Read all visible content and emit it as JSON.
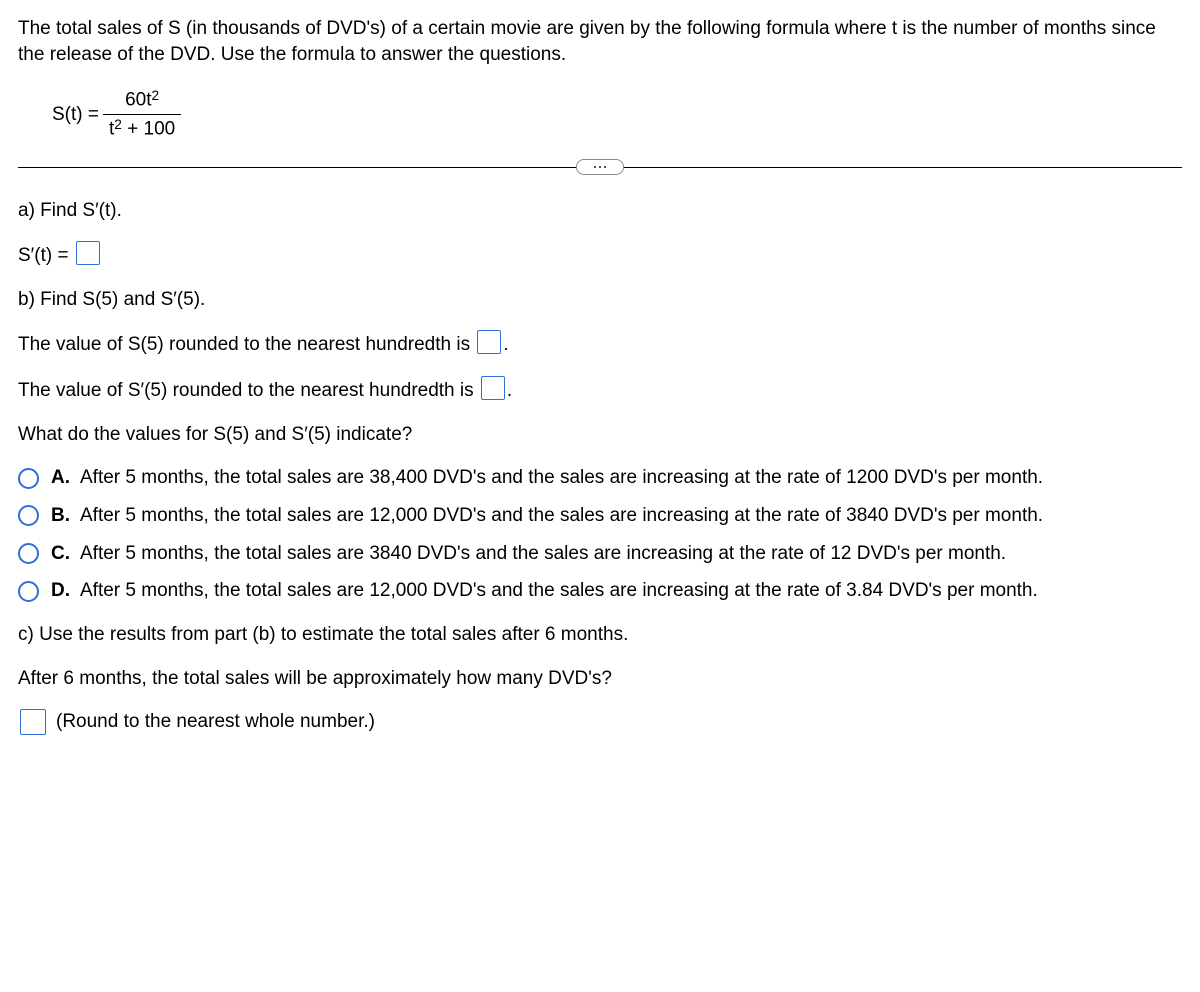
{
  "intro": "The total sales of S (in thousands of DVD's) of a certain movie are given by the following formula where t is the number of months since the release of the DVD. Use the formula to answer the questions.",
  "formula": {
    "lhs": "S(t) =",
    "num_coeff": "60t",
    "num_exp": "2",
    "den_base": "t",
    "den_exp": "2",
    "den_rest": " + 100"
  },
  "partA": {
    "prompt": "a) Find S′(t).",
    "lhs": "S′(t) ="
  },
  "partB": {
    "prompt": "b) Find S(5) and S′(5).",
    "s5_text": "The value of S(5) rounded to the nearest hundredth is ",
    "sprime5_text": "The value of S′(5) rounded to the nearest hundredth is ",
    "period": ".",
    "indicate_q": "What do the values for S(5) and S′(5) indicate?"
  },
  "options": [
    {
      "letter": "A.",
      "text": "After 5 months, the total sales are 38,400 DVD's and the sales are increasing at the rate of 1200 DVD's per month."
    },
    {
      "letter": "B.",
      "text": "After 5 months, the total sales are 12,000 DVD's and the sales are increasing at the rate of 3840 DVD's per month."
    },
    {
      "letter": "C.",
      "text": "After 5 months, the total sales are 3840 DVD's and the sales are increasing at the rate of 12 DVD's per month."
    },
    {
      "letter": "D.",
      "text": "After 5 months, the total sales are 12,000 DVD's and the sales are increasing at the rate of 3.84 DVD's per month."
    }
  ],
  "partC": {
    "prompt": "c) Use the results from part (b) to estimate the total sales after 6 months.",
    "q": "After 6 months, the total sales will be approximately how many DVD's?",
    "hint": "(Round to the nearest whole number.)"
  }
}
